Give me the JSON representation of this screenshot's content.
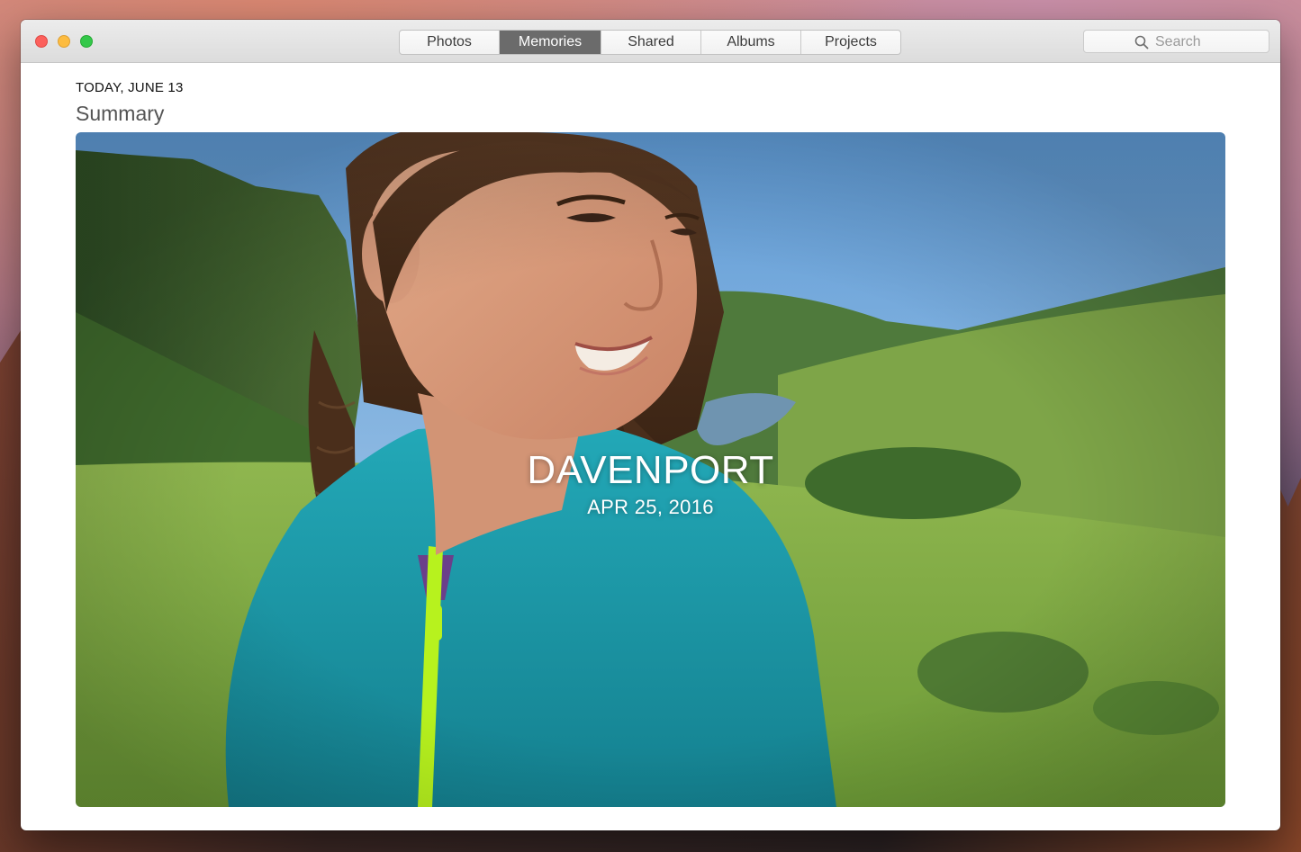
{
  "window": {
    "tabs": [
      {
        "label": "Photos",
        "active": false
      },
      {
        "label": "Memories",
        "active": true
      },
      {
        "label": "Shared",
        "active": false
      },
      {
        "label": "Albums",
        "active": false
      },
      {
        "label": "Projects",
        "active": false
      }
    ],
    "search": {
      "placeholder": "Search",
      "icon": "magnifying-glass"
    }
  },
  "content": {
    "date_header": "TODAY, JUNE 13",
    "section_title": "Summary",
    "memory": {
      "title": "DAVENPORT",
      "date": "APR 25, 2016"
    }
  }
}
